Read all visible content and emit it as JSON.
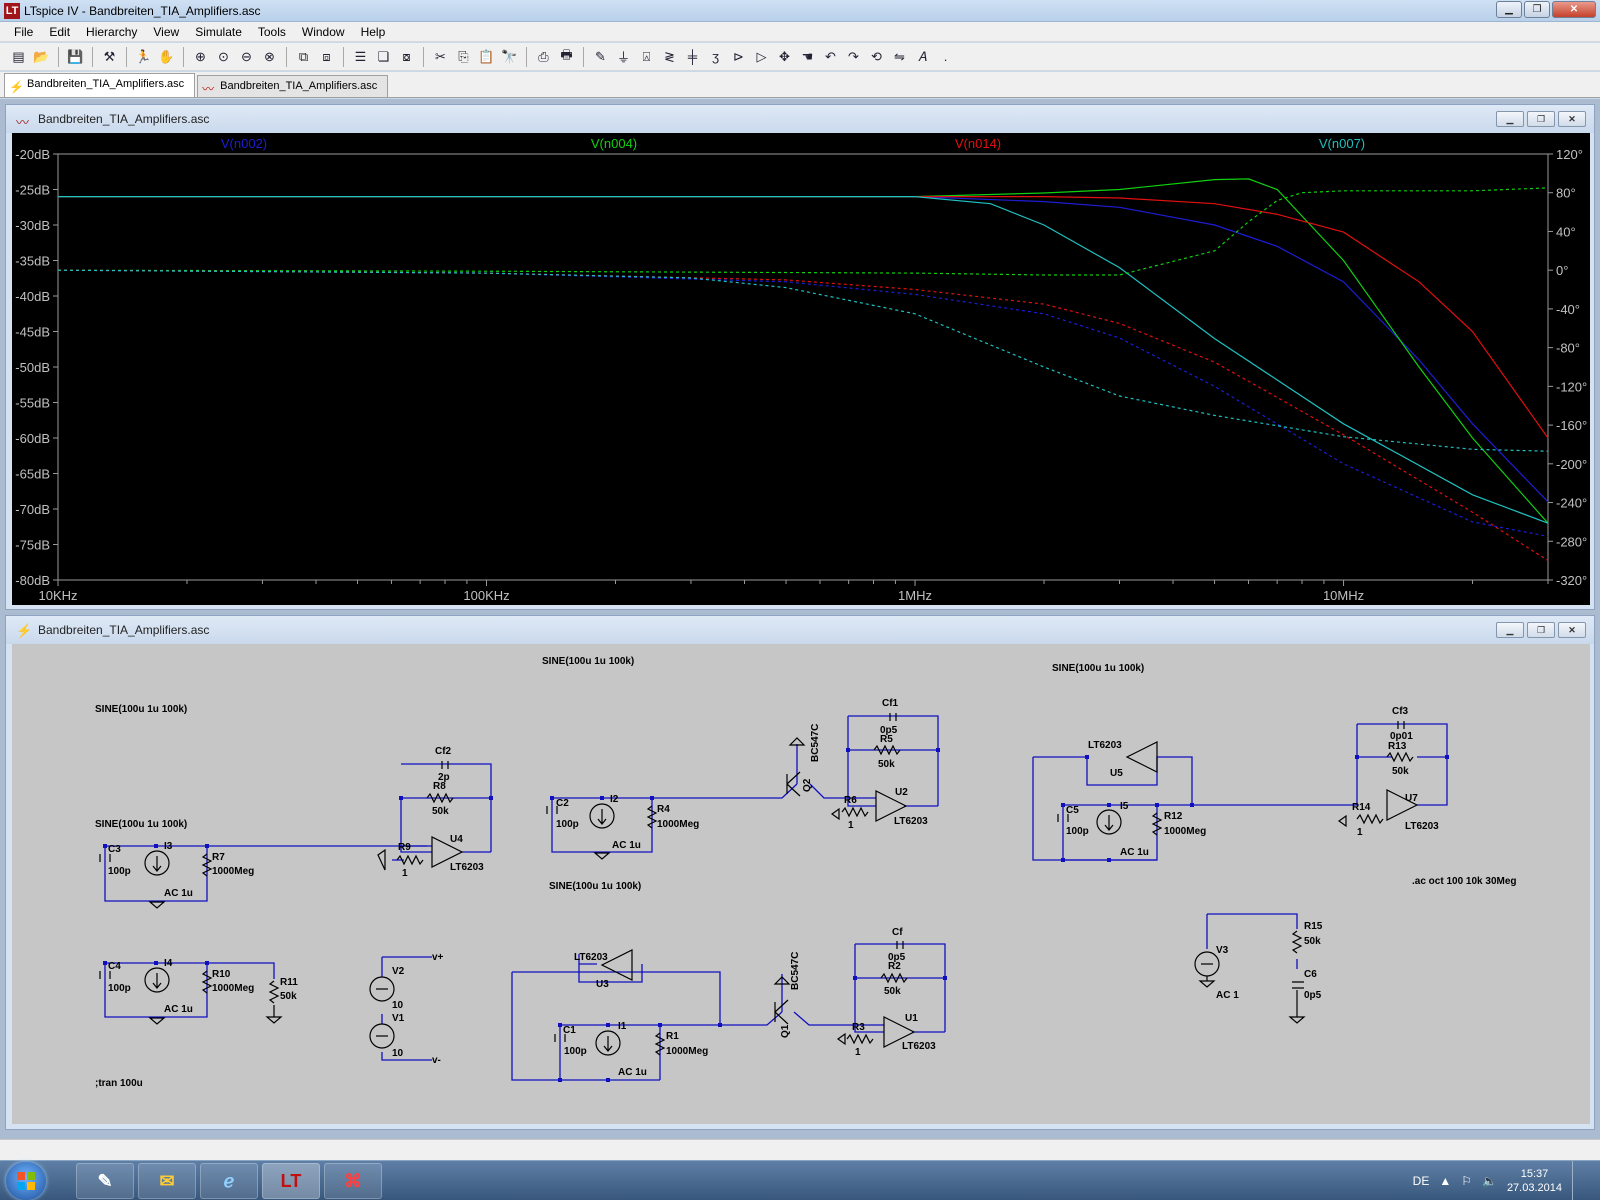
{
  "window": {
    "title": "LTspice IV - Bandbreiten_TIA_Amplifiers.asc",
    "app_icon": "LT",
    "buttons": {
      "minimize": "▁",
      "maximize": "❐",
      "close": "✕"
    }
  },
  "menu": [
    "File",
    "Edit",
    "Hierarchy",
    "View",
    "Simulate",
    "Tools",
    "Window",
    "Help"
  ],
  "tabs": [
    {
      "label": "Bandbreiten_TIA_Amplifiers.asc",
      "icon": "schematic-icon"
    },
    {
      "label": "Bandbreiten_TIA_Amplifiers.asc",
      "icon": "waveform-icon"
    }
  ],
  "plot_window": {
    "title": "Bandbreiten_TIA_Amplifiers.asc",
    "traces": [
      {
        "label": "V(n002)",
        "color": "#1d1dd6"
      },
      {
        "label": "V(n004)",
        "color": "#10d010"
      },
      {
        "label": "V(n014)",
        "color": "#e01010"
      },
      {
        "label": "V(n007)",
        "color": "#20c0c0"
      }
    ],
    "left_ticks": [
      "-20dB",
      "-25dB",
      "-30dB",
      "-35dB",
      "-40dB",
      "-45dB",
      "-50dB",
      "-55dB",
      "-60dB",
      "-65dB",
      "-70dB",
      "-75dB",
      "-80dB"
    ],
    "right_ticks": [
      "120°",
      "80°",
      "40°",
      "0°",
      "-40°",
      "-80°",
      "-120°",
      "-160°",
      "-200°",
      "-240°",
      "-280°",
      "-320°"
    ],
    "x_ticks": [
      "10KHz",
      "100KHz",
      "1MHz",
      "10MHz"
    ]
  },
  "chart_data": {
    "type": "line",
    "x_scale": "log",
    "xlim": [
      10000,
      30000000
    ],
    "ylim_left": [
      -80,
      -20
    ],
    "ylim_right": [
      -320,
      120
    ],
    "grid": false,
    "series": [
      {
        "name": "V(n002)",
        "axis": "magnitude_dB",
        "x": [
          10000,
          100000,
          1000000,
          2000000,
          3000000,
          5000000,
          7000000,
          10000000,
          15000000,
          20000000,
          30000000
        ],
        "values": [
          -26,
          -26,
          -26,
          -26.7,
          -27.5,
          -30,
          -33,
          -38,
          -49,
          -58,
          -69
        ]
      },
      {
        "name": "V(n004)",
        "axis": "magnitude_dB",
        "x": [
          10000,
          100000,
          1000000,
          2000000,
          3000000,
          5000000,
          6000000,
          7000000,
          10000000,
          15000000,
          20000000,
          30000000
        ],
        "values": [
          -26,
          -26,
          -26,
          -25.5,
          -25,
          -23.6,
          -23.5,
          -25,
          -35,
          -50,
          -60,
          -72
        ]
      },
      {
        "name": "V(n014)",
        "axis": "magnitude_dB",
        "x": [
          10000,
          100000,
          1000000,
          2000000,
          3000000,
          5000000,
          7000000,
          10000000,
          15000000,
          20000000,
          30000000
        ],
        "values": [
          -26,
          -26,
          -26,
          -26,
          -26.2,
          -27,
          -28.5,
          -31,
          -38,
          -45,
          -60
        ]
      },
      {
        "name": "V(n007)",
        "axis": "magnitude_dB",
        "x": [
          10000,
          100000,
          1000000,
          1500000,
          2000000,
          3000000,
          5000000,
          10000000,
          20000000,
          30000000
        ],
        "values": [
          -26,
          -26,
          -26,
          -27,
          -30,
          -36,
          -46,
          -58,
          -68,
          -72
        ]
      },
      {
        "name": "V(n002)",
        "axis": "phase_deg",
        "x": [
          10000,
          100000,
          500000,
          1000000,
          2000000,
          3000000,
          5000000,
          10000000,
          20000000,
          30000000
        ],
        "values": [
          0,
          -3,
          -12,
          -25,
          -45,
          -70,
          -120,
          -200,
          -260,
          -275
        ]
      },
      {
        "name": "V(n004)",
        "axis": "phase_deg",
        "x": [
          10000,
          100000,
          1000000,
          2000000,
          3000000,
          5000000,
          6000000,
          7000000,
          8000000,
          10000000,
          20000000,
          30000000
        ],
        "values": [
          0,
          -1,
          -3,
          -5,
          -5,
          20,
          50,
          72,
          80,
          82,
          82,
          85
        ]
      },
      {
        "name": "V(n014)",
        "axis": "phase_deg",
        "x": [
          10000,
          100000,
          500000,
          1000000,
          2000000,
          3000000,
          5000000,
          10000000,
          20000000,
          30000000
        ],
        "values": [
          0,
          -3,
          -10,
          -20,
          -35,
          -55,
          -95,
          -170,
          -250,
          -300
        ]
      },
      {
        "name": "V(n007)",
        "axis": "phase_deg",
        "x": [
          10000,
          100000,
          300000,
          500000,
          1000000,
          2000000,
          3000000,
          5000000,
          10000000,
          20000000,
          30000000
        ],
        "values": [
          0,
          -3,
          -8,
          -18,
          -45,
          -100,
          -130,
          -150,
          -172,
          -185,
          -187
        ]
      }
    ]
  },
  "schematic_window": {
    "title": "Bandbreiten_TIA_Amplifiers.asc",
    "directives": {
      "sine1": "SINE(100u 1u 100k)",
      "sine2": "SINE(100u 1u 100k)",
      "sine3": "SINE(100u 1u 100k)",
      "sine4": "SINE(100u 1u 100k)",
      "sine5": "SINE(100u 1u 100k)",
      "ac": ".ac oct 100 10k 30Meg",
      "tran": ";tran 100u"
    },
    "labels": {
      "cf2": "Cf2",
      "cf2v": "2p",
      "r8": "R8",
      "r8v": "50k",
      "r9": "R9",
      "r9v": "1",
      "u4": "U4",
      "lt_u4": "LT6203",
      "c3": "C3",
      "c3v": "100p",
      "i3": "I3",
      "ac_i3": "AC 1u",
      "r7": "R7",
      "r7v": "1000Meg",
      "c4": "C4",
      "c4v": "100p",
      "i4": "I4",
      "ac_i4": "AC 1u",
      "r10": "R10",
      "r10v": "1000Meg",
      "r11": "R11",
      "r11v": "50k",
      "v2": "V2",
      "v2v": "10",
      "v1": "V1",
      "v1v": "10",
      "vplus": "v+",
      "vminus": "v-",
      "c2": "C2",
      "c2v": "100p",
      "i2": "I2",
      "ac_i2": "AC 1u",
      "r4": "R4",
      "r4v": "1000Meg",
      "q2": "Q2",
      "bc2": "BC547C",
      "cf1": "Cf1",
      "cf1v": "0p5",
      "r5": "R5",
      "r5v": "50k",
      "r6": "R6",
      "r6v": "1",
      "u2": "U2",
      "lt_u2": "LT6203",
      "u3lt": "LT6203",
      "u3": "U3",
      "c1": "C1",
      "c1v": "100p",
      "i1": "I1",
      "ac_i1": "AC 1u",
      "r1": "R1",
      "r1v": "1000Meg",
      "q1": "Q1",
      "bc1": "BC547C",
      "cf": "Cf",
      "cfv": "0p5",
      "r2": "R2",
      "r2v": "50k",
      "r3": "R3",
      "r3v": "1",
      "u1": "U1",
      "lt_u1": "LT6203",
      "u5lt": "LT6203",
      "u5": "U5",
      "c5": "C5",
      "c5v": "100p",
      "i5": "I5",
      "ac_i5": "AC 1u",
      "r12": "R12",
      "r12v": "1000Meg",
      "cf3": "Cf3",
      "cf3v": "0p01",
      "r13": "R13",
      "r13v": "50k",
      "r14": "R14",
      "r14v": "1",
      "u7": "U7",
      "lt_u7": "LT6203",
      "r15": "R15",
      "r15v": "50k",
      "v3": "V3",
      "ac_v3": "AC 1",
      "c6": "C6",
      "c6v": "0p5"
    }
  },
  "taskbar": {
    "apps": [
      "paint-icon",
      "outlook-icon",
      "ie-icon",
      "ltspice-icon",
      "acrobat-icon"
    ],
    "language": "DE",
    "time": "15:37",
    "date": "27.03.2014"
  }
}
